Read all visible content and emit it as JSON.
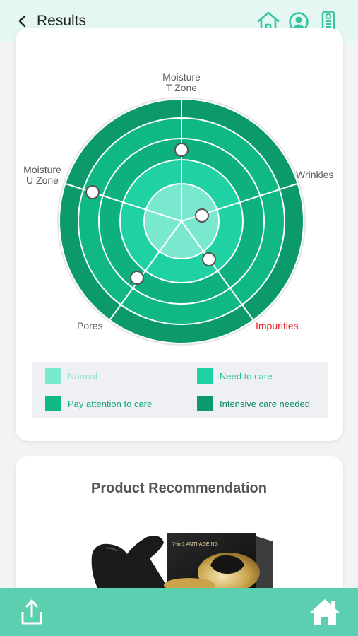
{
  "header": {
    "title": "Results",
    "icons": [
      "chevron-left-icon",
      "home-icon",
      "user-icon",
      "remote-device-icon"
    ]
  },
  "radar": {
    "labels": {
      "moisture_t": [
        "Moisture",
        "T Zone"
      ],
      "wrinkles": "Wrinkles",
      "impurities": "Impurities",
      "pores": "Pores",
      "moisture_u": [
        "Moisture",
        "U Zone"
      ]
    },
    "highlight_color": "#e8212a"
  },
  "legend": {
    "normal": "Normal",
    "need_to_care": "Need to care",
    "pay_attention": "Pay attention to care",
    "intensive": "Intensive care needed"
  },
  "colors": {
    "normal": "#7ae8cf",
    "need_to_care": "#1fd1a3",
    "pay_attention": "#10b884",
    "intensive": "#0c9a6c",
    "accent": "#5ccfb0"
  },
  "recommendation": {
    "title": "Product Recommendation",
    "box_text": "7-in-1 ANTI-AGEING"
  },
  "bottom": {
    "icons": [
      "share-icon",
      "home-icon"
    ]
  }
}
